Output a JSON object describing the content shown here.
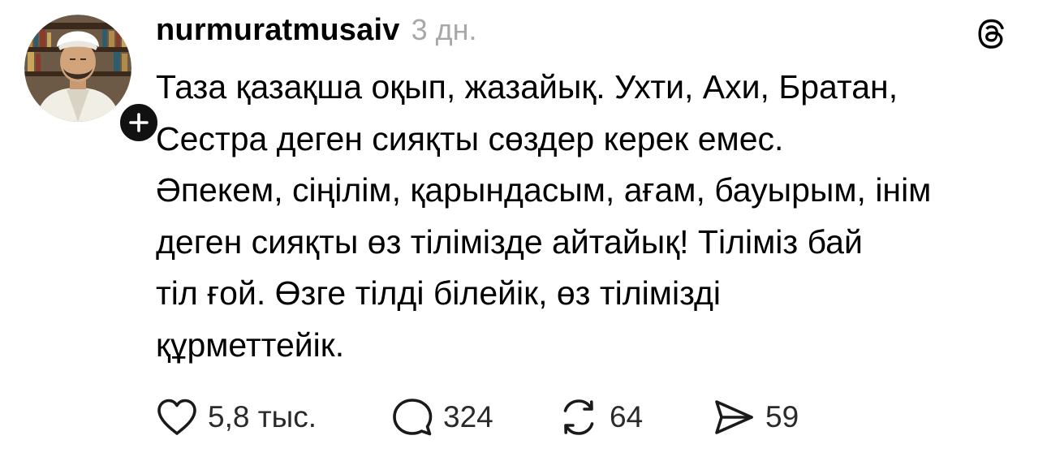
{
  "post": {
    "username": "nurmuratmusaiv",
    "time": "3 дн.",
    "text": "Таза қазақша оқып, жазайық. Ухти, Ахи, Братан,\nСестра деген сияқты сөздер керек емес.\nӘпекем, сіңілім, қарындасым, ағам, бауырым, інім\nдеген сияқты өз тілімізде айтайық! Тіліміз бай\nтіл ғой. Өзге тілді білейік, өз тілімізді\nқұрметтейік.",
    "avatar_icon": "user-avatar",
    "follow_icon": "plus-icon",
    "brand_icon": "threads-logo-icon"
  },
  "actions": {
    "likes": "5,8 тыс.",
    "replies": "324",
    "reposts": "64",
    "shares": "59"
  },
  "colors": {
    "text": "#000000",
    "muted": "#a8a8a8",
    "follow_button": "#111111"
  }
}
